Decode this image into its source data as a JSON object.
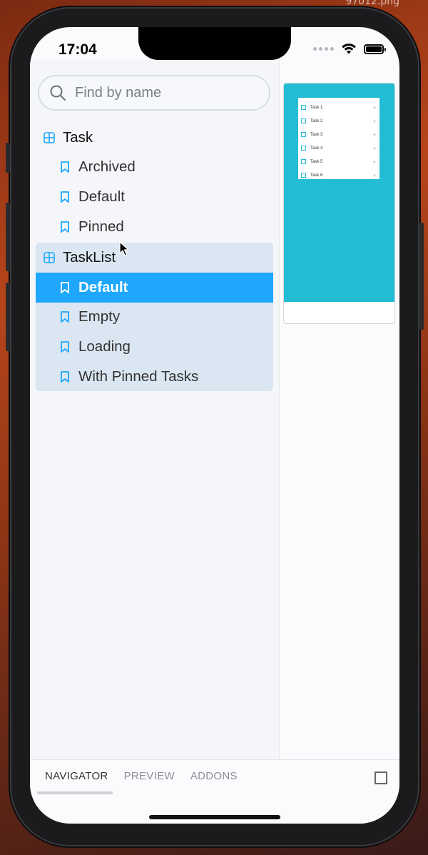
{
  "file_label": "97012.png",
  "status": {
    "time": "17:04"
  },
  "sidebar": {
    "search": {
      "placeholder": "Find by name",
      "value": ""
    },
    "groups": [
      {
        "component": "Task",
        "stories": [
          "Archived",
          "Default",
          "Pinned"
        ]
      },
      {
        "component": "TaskList",
        "stories": [
          "Default",
          "Empty",
          "Loading",
          "With Pinned Tasks"
        ],
        "selected_story": "Default"
      }
    ]
  },
  "preview": {
    "items": [
      "Task 1",
      "Task 2",
      "Task 3",
      "Task 4",
      "Task 5",
      "Task 6"
    ],
    "background_color": "#22bcd5"
  },
  "bottom_tabs": [
    "NAVIGATOR",
    "PREVIEW",
    "ADDONS"
  ],
  "active_tab": "NAVIGATOR",
  "colors": {
    "accent": "#1ea7fd",
    "selected_group_bg": "#dae6f1",
    "icon": "#1ea7fd"
  },
  "icons": {
    "component": "component-grid-icon",
    "story": "bookmark-icon",
    "search": "search-icon",
    "panel_toggle": "panel-toggle-icon"
  }
}
